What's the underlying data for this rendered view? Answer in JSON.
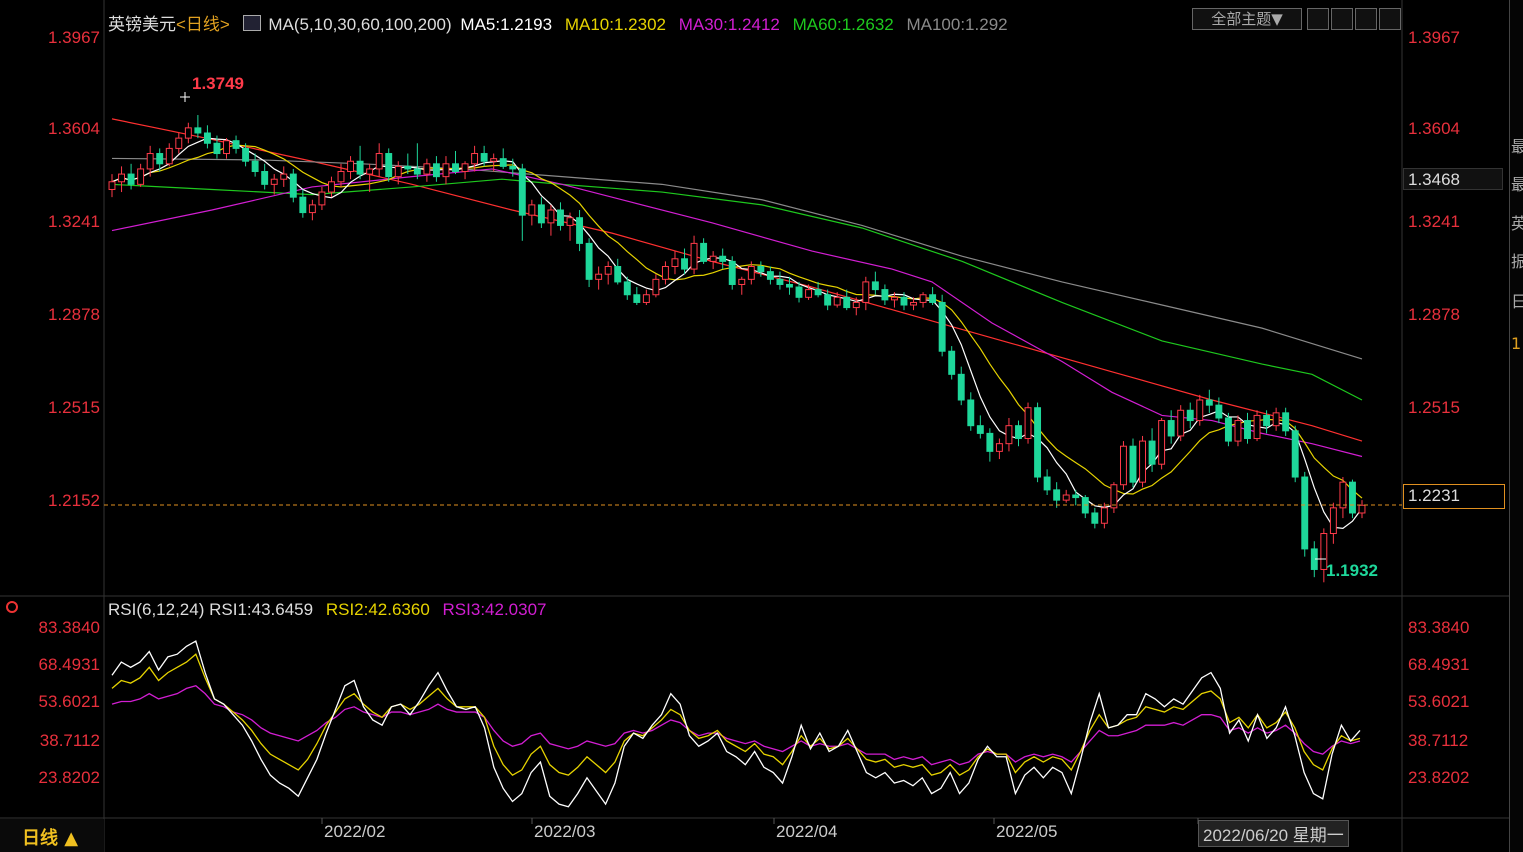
{
  "header": {
    "symbol": "英镑美元",
    "period_tag": "<日线>",
    "ma_params": "MA(5,10,30,60,100,200)",
    "ma5": "MA5:1.2193",
    "ma10": "MA10:1.2302",
    "ma30": "MA30:1.2412",
    "ma60": "MA60:1.2632",
    "ma100": "MA100:1.292",
    "theme_button": "全部主题▼"
  },
  "rsi_header": {
    "params": "RSI(6,12,24)",
    "rsi1": "RSI1:43.6459",
    "rsi2": "RSI2:42.6360",
    "rsi3": "RSI3:42.0307"
  },
  "price_axis": [
    "1.3967",
    "1.3604",
    "1.3241",
    "1.2878",
    "1.2515",
    "1.2152"
  ],
  "rsi_axis": [
    "83.3840",
    "68.4931",
    "53.6021",
    "38.7112",
    "23.8202"
  ],
  "current_price_label": "1.2231",
  "cursor_price_label": "1.3468",
  "high_label": "1.3749",
  "low_label": "1.1932",
  "dates": [
    "2022/02",
    "2022/03",
    "2022/04",
    "2022/05",
    "2022/06/20 星期一"
  ],
  "period_button": "日线 ▲",
  "right_panel_chars": [
    "最",
    "最",
    "英",
    "振",
    "日",
    "1"
  ],
  "colors": {
    "up": "#ff3b4a",
    "down": "#1ed79a",
    "ma5": "#ffffff",
    "ma10": "#e6d300",
    "ma30": "#d21ed2",
    "ma60": "#1ec81e",
    "ma100": "#8a8a8a",
    "ma200": "#ff3030",
    "rsi1": "#ffffff",
    "rsi2": "#e6d300",
    "rsi3": "#d21ed2",
    "axis_text": "#e8303c",
    "current_line": "#e09020"
  },
  "chart_data": {
    "type": "candlestick",
    "title": "英镑美元 日线",
    "y_range": [
      1.19,
      1.405
    ],
    "rsi_range": [
      15,
      88
    ],
    "candles_ohlc": [
      [
        1.346,
        1.352,
        1.343,
        1.349
      ],
      [
        1.349,
        1.355,
        1.345,
        1.352
      ],
      [
        1.352,
        1.356,
        1.346,
        1.348
      ],
      [
        1.348,
        1.356,
        1.347,
        1.354
      ],
      [
        1.354,
        1.363,
        1.351,
        1.36
      ],
      [
        1.36,
        1.362,
        1.353,
        1.356
      ],
      [
        1.356,
        1.364,
        1.355,
        1.362
      ],
      [
        1.362,
        1.368,
        1.36,
        1.366
      ],
      [
        1.366,
        1.372,
        1.364,
        1.37
      ],
      [
        1.37,
        1.375,
        1.366,
        1.368
      ],
      [
        1.368,
        1.371,
        1.362,
        1.364
      ],
      [
        1.364,
        1.367,
        1.358,
        1.36
      ],
      [
        1.36,
        1.366,
        1.358,
        1.365
      ],
      [
        1.365,
        1.367,
        1.36,
        1.362
      ],
      [
        1.362,
        1.364,
        1.355,
        1.357
      ],
      [
        1.357,
        1.36,
        1.351,
        1.353
      ],
      [
        1.353,
        1.356,
        1.346,
        1.348
      ],
      [
        1.348,
        1.352,
        1.344,
        1.35
      ],
      [
        1.35,
        1.355,
        1.347,
        1.352
      ],
      [
        1.352,
        1.354,
        1.341,
        1.343
      ],
      [
        1.343,
        1.346,
        1.335,
        1.337
      ],
      [
        1.337,
        1.342,
        1.334,
        1.34
      ],
      [
        1.34,
        1.347,
        1.338,
        1.345
      ],
      [
        1.345,
        1.351,
        1.343,
        1.349
      ],
      [
        1.349,
        1.356,
        1.347,
        1.353
      ],
      [
        1.353,
        1.359,
        1.35,
        1.357
      ],
      [
        1.357,
        1.363,
        1.35,
        1.352
      ],
      [
        1.352,
        1.356,
        1.345,
        1.354
      ],
      [
        1.354,
        1.364,
        1.351,
        1.36
      ],
      [
        1.36,
        1.362,
        1.349,
        1.351
      ],
      [
        1.351,
        1.357,
        1.348,
        1.355
      ],
      [
        1.355,
        1.36,
        1.352,
        1.354
      ],
      [
        1.354,
        1.364,
        1.35,
        1.352
      ],
      [
        1.352,
        1.358,
        1.349,
        1.356
      ],
      [
        1.356,
        1.359,
        1.349,
        1.351
      ],
      [
        1.351,
        1.359,
        1.348,
        1.356
      ],
      [
        1.356,
        1.361,
        1.352,
        1.353
      ],
      [
        1.353,
        1.357,
        1.35,
        1.356
      ],
      [
        1.356,
        1.363,
        1.353,
        1.36
      ],
      [
        1.36,
        1.363,
        1.355,
        1.357
      ],
      [
        1.357,
        1.36,
        1.353,
        1.358
      ],
      [
        1.358,
        1.362,
        1.354,
        1.355
      ],
      [
        1.355,
        1.358,
        1.351,
        1.354
      ],
      [
        1.354,
        1.356,
        1.326,
        1.336
      ],
      [
        1.336,
        1.342,
        1.332,
        1.34
      ],
      [
        1.34,
        1.343,
        1.331,
        1.333
      ],
      [
        1.333,
        1.34,
        1.328,
        1.338
      ],
      [
        1.338,
        1.341,
        1.33,
        1.332
      ],
      [
        1.332,
        1.337,
        1.326,
        1.335
      ],
      [
        1.335,
        1.338,
        1.322,
        1.325
      ],
      [
        1.325,
        1.327,
        1.308,
        1.311
      ],
      [
        1.311,
        1.316,
        1.307,
        1.313
      ],
      [
        1.313,
        1.318,
        1.309,
        1.316
      ],
      [
        1.316,
        1.319,
        1.309,
        1.31
      ],
      [
        1.31,
        1.312,
        1.303,
        1.305
      ],
      [
        1.305,
        1.308,
        1.301,
        1.302
      ],
      [
        1.302,
        1.307,
        1.301,
        1.305
      ],
      [
        1.305,
        1.313,
        1.304,
        1.311
      ],
      [
        1.311,
        1.318,
        1.309,
        1.316
      ],
      [
        1.316,
        1.322,
        1.313,
        1.319
      ],
      [
        1.319,
        1.323,
        1.313,
        1.315
      ],
      [
        1.315,
        1.328,
        1.313,
        1.325
      ],
      [
        1.325,
        1.327,
        1.317,
        1.318
      ],
      [
        1.318,
        1.322,
        1.315,
        1.32
      ],
      [
        1.32,
        1.323,
        1.315,
        1.318
      ],
      [
        1.318,
        1.32,
        1.307,
        1.309
      ],
      [
        1.309,
        1.312,
        1.305,
        1.311
      ],
      [
        1.311,
        1.318,
        1.309,
        1.316
      ],
      [
        1.316,
        1.318,
        1.312,
        1.314
      ],
      [
        1.314,
        1.316,
        1.309,
        1.311
      ],
      [
        1.311,
        1.314,
        1.307,
        1.309
      ],
      [
        1.309,
        1.312,
        1.305,
        1.308
      ],
      [
        1.308,
        1.31,
        1.302,
        1.304
      ],
      [
        1.304,
        1.309,
        1.303,
        1.307
      ],
      [
        1.307,
        1.31,
        1.304,
        1.305
      ],
      [
        1.305,
        1.307,
        1.299,
        1.301
      ],
      [
        1.301,
        1.306,
        1.3,
        1.304
      ],
      [
        1.304,
        1.307,
        1.299,
        1.3
      ],
      [
        1.3,
        1.304,
        1.297,
        1.302
      ],
      [
        1.302,
        1.312,
        1.299,
        1.31
      ],
      [
        1.31,
        1.314,
        1.305,
        1.307
      ],
      [
        1.307,
        1.309,
        1.301,
        1.303
      ],
      [
        1.303,
        1.306,
        1.3,
        1.304
      ],
      [
        1.304,
        1.306,
        1.299,
        1.301
      ],
      [
        1.301,
        1.304,
        1.299,
        1.302
      ],
      [
        1.302,
        1.306,
        1.3,
        1.305
      ],
      [
        1.305,
        1.308,
        1.301,
        1.302
      ],
      [
        1.302,
        1.305,
        1.281,
        1.283
      ],
      [
        1.283,
        1.285,
        1.272,
        1.274
      ],
      [
        1.274,
        1.277,
        1.262,
        1.264
      ],
      [
        1.264,
        1.267,
        1.252,
        1.254
      ],
      [
        1.254,
        1.258,
        1.249,
        1.251
      ],
      [
        1.251,
        1.253,
        1.24,
        1.244
      ],
      [
        1.244,
        1.249,
        1.241,
        1.247
      ],
      [
        1.247,
        1.257,
        1.244,
        1.254
      ],
      [
        1.254,
        1.256,
        1.246,
        1.249
      ],
      [
        1.249,
        1.263,
        1.247,
        1.261
      ],
      [
        1.261,
        1.263,
        1.232,
        1.234
      ],
      [
        1.234,
        1.237,
        1.227,
        1.229
      ],
      [
        1.229,
        1.232,
        1.222,
        1.225
      ],
      [
        1.225,
        1.229,
        1.224,
        1.227
      ],
      [
        1.227,
        1.229,
        1.223,
        1.226
      ],
      [
        1.226,
        1.227,
        1.218,
        1.22
      ],
      [
        1.22,
        1.222,
        1.214,
        1.216
      ],
      [
        1.216,
        1.224,
        1.214,
        1.222
      ],
      [
        1.222,
        1.232,
        1.22,
        1.231
      ],
      [
        1.231,
        1.248,
        1.229,
        1.246
      ],
      [
        1.246,
        1.249,
        1.23,
        1.232
      ],
      [
        1.232,
        1.25,
        1.23,
        1.248
      ],
      [
        1.248,
        1.253,
        1.236,
        1.239
      ],
      [
        1.239,
        1.257,
        1.237,
        1.256
      ],
      [
        1.256,
        1.26,
        1.247,
        1.25
      ],
      [
        1.25,
        1.262,
        1.248,
        1.26
      ],
      [
        1.26,
        1.263,
        1.253,
        1.256
      ],
      [
        1.256,
        1.266,
        1.254,
        1.264
      ],
      [
        1.264,
        1.268,
        1.259,
        1.262
      ],
      [
        1.262,
        1.265,
        1.255,
        1.257
      ],
      [
        1.257,
        1.259,
        1.246,
        1.248
      ],
      [
        1.248,
        1.258,
        1.246,
        1.256
      ],
      [
        1.256,
        1.259,
        1.247,
        1.249
      ],
      [
        1.249,
        1.26,
        1.248,
        1.258
      ],
      [
        1.258,
        1.26,
        1.251,
        1.254
      ],
      [
        1.254,
        1.261,
        1.252,
        1.259
      ],
      [
        1.259,
        1.261,
        1.25,
        1.252
      ],
      [
        1.252,
        1.254,
        1.232,
        1.234
      ],
      [
        1.234,
        1.236,
        1.203,
        1.206
      ],
      [
        1.206,
        1.209,
        1.195,
        1.198
      ],
      [
        1.198,
        1.214,
        1.193,
        1.212
      ],
      [
        1.212,
        1.224,
        1.208,
        1.222
      ],
      [
        1.222,
        1.234,
        1.218,
        1.232
      ],
      [
        1.232,
        1.233,
        1.218,
        1.22
      ],
      [
        1.22,
        1.225,
        1.218,
        1.223
      ]
    ],
    "ma_lines": {
      "ma200": [
        [
          0,
          1.3735
        ],
        [
          100,
          1.3655
        ],
        [
          200,
          1.357
        ],
        [
          300,
          1.348
        ],
        [
          400,
          1.338
        ],
        [
          500,
          1.329
        ],
        [
          600,
          1.318
        ],
        [
          700,
          1.308
        ],
        [
          800,
          1.297
        ],
        [
          900,
          1.286
        ],
        [
          1000,
          1.275
        ],
        [
          1100,
          1.264
        ],
        [
          1200,
          1.254
        ],
        [
          1250,
          1.248
        ]
      ],
      "ma100": [
        [
          0,
          1.3581
        ],
        [
          150,
          1.3575
        ],
        [
          250,
          1.356
        ],
        [
          350,
          1.354
        ],
        [
          450,
          1.351
        ],
        [
          550,
          1.348
        ],
        [
          650,
          1.342
        ],
        [
          750,
          1.332
        ],
        [
          850,
          1.32
        ],
        [
          950,
          1.31
        ],
        [
          1050,
          1.301
        ],
        [
          1150,
          1.292
        ],
        [
          1250,
          1.28
        ]
      ],
      "ma60": [
        [
          0,
          1.348
        ],
        [
          100,
          1.346
        ],
        [
          200,
          1.344
        ],
        [
          300,
          1.347
        ],
        [
          390,
          1.35
        ],
        [
          450,
          1.348
        ],
        [
          550,
          1.345
        ],
        [
          650,
          1.34
        ],
        [
          750,
          1.331
        ],
        [
          850,
          1.318
        ],
        [
          950,
          1.302
        ],
        [
          1050,
          1.287
        ],
        [
          1150,
          1.278
        ],
        [
          1200,
          1.274
        ],
        [
          1250,
          1.264
        ]
      ],
      "ma30": [
        [
          0,
          1.33
        ],
        [
          100,
          1.338
        ],
        [
          200,
          1.347
        ],
        [
          300,
          1.351
        ],
        [
          380,
          1.354
        ],
        [
          450,
          1.348
        ],
        [
          520,
          1.341
        ],
        [
          600,
          1.333
        ],
        [
          700,
          1.322
        ],
        [
          780,
          1.315
        ],
        [
          820,
          1.31
        ],
        [
          880,
          1.294
        ],
        [
          950,
          1.279
        ],
        [
          1000,
          1.267
        ],
        [
          1050,
          1.258
        ],
        [
          1100,
          1.256
        ],
        [
          1150,
          1.251
        ],
        [
          1200,
          1.247
        ],
        [
          1250,
          1.242
        ]
      ]
    },
    "rsi": {
      "rsi1": [
        67,
        72,
        70,
        72,
        76,
        69,
        74,
        75,
        78,
        80,
        68,
        58,
        56,
        52,
        48,
        42,
        35,
        29,
        26,
        24,
        21,
        28,
        35,
        45,
        54,
        63,
        65,
        55,
        50,
        48,
        55,
        56,
        52,
        57,
        63,
        68,
        61,
        55,
        54,
        55,
        47,
        32,
        24,
        19,
        22,
        30,
        34,
        21,
        18,
        17,
        22,
        28,
        23,
        18,
        26,
        40,
        45,
        43,
        48,
        52,
        60,
        56,
        44,
        40,
        42,
        45,
        38,
        36,
        33,
        38,
        32,
        30,
        26,
        36,
        48,
        39,
        45,
        38,
        40,
        46,
        38,
        30,
        28,
        30,
        26,
        27,
        25,
        28,
        22,
        24,
        30,
        22,
        26,
        35,
        40,
        36,
        36,
        22,
        29,
        32,
        28,
        32,
        30,
        22,
        35,
        49,
        60,
        47,
        48,
        52,
        52,
        60,
        58,
        55,
        58,
        56,
        61,
        66,
        68,
        62,
        45,
        50,
        42,
        52,
        43,
        47,
        55,
        44,
        30,
        22,
        20,
        37,
        48,
        42,
        46
      ],
      "rsi2": [
        62,
        65,
        64,
        66,
        70,
        65,
        68,
        70,
        72,
        75,
        66,
        58,
        56,
        53,
        50,
        46,
        41,
        37,
        35,
        33,
        31,
        35,
        41,
        48,
        53,
        58,
        60,
        56,
        53,
        51,
        55,
        56,
        54,
        56,
        59,
        62,
        58,
        55,
        55,
        55,
        51,
        40,
        33,
        29,
        31,
        37,
        40,
        33,
        30,
        29,
        32,
        36,
        33,
        30,
        34,
        42,
        45,
        44,
        47,
        50,
        54,
        52,
        46,
        43,
        44,
        46,
        42,
        40,
        38,
        41,
        37,
        36,
        33,
        38,
        44,
        40,
        43,
        39,
        40,
        43,
        39,
        35,
        34,
        35,
        32,
        33,
        32,
        33,
        29,
        30,
        33,
        29,
        31,
        36,
        39,
        37,
        37,
        30,
        34,
        36,
        34,
        36,
        35,
        31,
        38,
        46,
        52,
        47,
        48,
        50,
        51,
        55,
        54,
        53,
        55,
        54,
        57,
        60,
        61,
        58,
        49,
        51,
        47,
        52,
        47,
        49,
        53,
        47,
        38,
        33,
        31,
        39,
        44,
        42,
        43
      ],
      "rsi3": [
        56,
        57,
        57,
        58,
        60,
        58,
        59,
        60,
        62,
        63,
        60,
        56,
        55,
        53,
        52,
        50,
        47,
        45,
        44,
        43,
        42,
        44,
        46,
        49,
        51,
        54,
        55,
        53,
        52,
        51,
        53,
        53,
        52,
        53,
        54,
        56,
        54,
        53,
        53,
        53,
        51,
        46,
        42,
        40,
        41,
        44,
        45,
        41,
        40,
        39,
        40,
        42,
        41,
        40,
        41,
        45,
        46,
        45,
        46,
        48,
        50,
        49,
        46,
        44,
        45,
        45,
        43,
        42,
        41,
        42,
        40,
        39,
        38,
        40,
        42,
        40,
        41,
        40,
        40,
        41,
        39,
        37,
        37,
        37,
        35,
        36,
        35,
        36,
        33,
        34,
        35,
        33,
        34,
        37,
        38,
        37,
        37,
        34,
        36,
        37,
        36,
        37,
        36,
        34,
        38,
        42,
        46,
        44,
        44,
        45,
        46,
        48,
        48,
        48,
        49,
        48,
        50,
        52,
        52,
        51,
        46,
        47,
        45,
        47,
        45,
        46,
        48,
        45,
        41,
        38,
        37,
        40,
        42,
        41,
        42
      ]
    }
  }
}
